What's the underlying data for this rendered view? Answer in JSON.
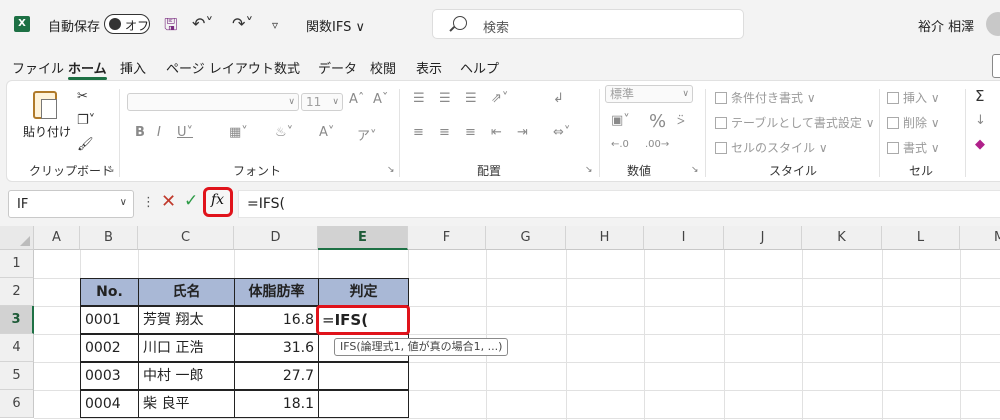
{
  "title_bar": {
    "app_logo": "X",
    "autosave_label": "自動保存",
    "autosave_toggle": "オフ",
    "doc_title": "関数IFS ∨",
    "search_placeholder": "検索",
    "user_name": "裕介 相澤"
  },
  "menu": {
    "tabs": [
      "ファイル",
      "ホーム",
      "挿入",
      "ページ レイアウト",
      "数式",
      "データ",
      "校閲",
      "表示",
      "ヘルプ"
    ],
    "active_tab": "ホーム"
  },
  "ribbon": {
    "clipboard": {
      "paste": "貼り付け",
      "label": "クリップボード"
    },
    "font": {
      "size": "11",
      "label": "フォント"
    },
    "alignment": {
      "label": "配置"
    },
    "number": {
      "format": "標準",
      "label": "数値"
    },
    "styles": {
      "conditional": "条件付き書式 ∨",
      "table": "テーブルとして書式設定 ∨",
      "cell_style": "セルのスタイル ∨",
      "label": "スタイル"
    },
    "cells": {
      "insert": "挿入 ∨",
      "delete": "削除 ∨",
      "format": "書式 ∨",
      "label": "セル"
    }
  },
  "formula_bar": {
    "name_box": "IF",
    "fx": "fx",
    "formula": "=IFS("
  },
  "grid": {
    "columns": [
      "A",
      "B",
      "C",
      "D",
      "E",
      "F",
      "G",
      "H",
      "I",
      "J",
      "K",
      "L",
      "M"
    ],
    "rows": [
      "1",
      "2",
      "3",
      "4",
      "5",
      "6"
    ],
    "selected_column": "E",
    "selected_row": "3"
  },
  "table": {
    "headers": [
      "No.",
      "氏名",
      "体脂肪率",
      "判定"
    ],
    "rows": [
      {
        "no": "0001",
        "name": "芳賀 翔太",
        "fat": "16.8"
      },
      {
        "no": "0002",
        "name": "川口 正浩",
        "fat": "31.6"
      },
      {
        "no": "0003",
        "name": "中村 一郎",
        "fat": "27.7"
      },
      {
        "no": "0004",
        "name": "柴 良平",
        "fat": "18.1"
      }
    ]
  },
  "active_cell": {
    "eq": "=",
    "func": "IFS("
  },
  "tooltip": "IFS(論理式1, 値が真の場合1, ...)",
  "colors": {
    "accent": "#1d7044",
    "highlight": "#e0131b",
    "table_header": "#a9b8d6"
  }
}
